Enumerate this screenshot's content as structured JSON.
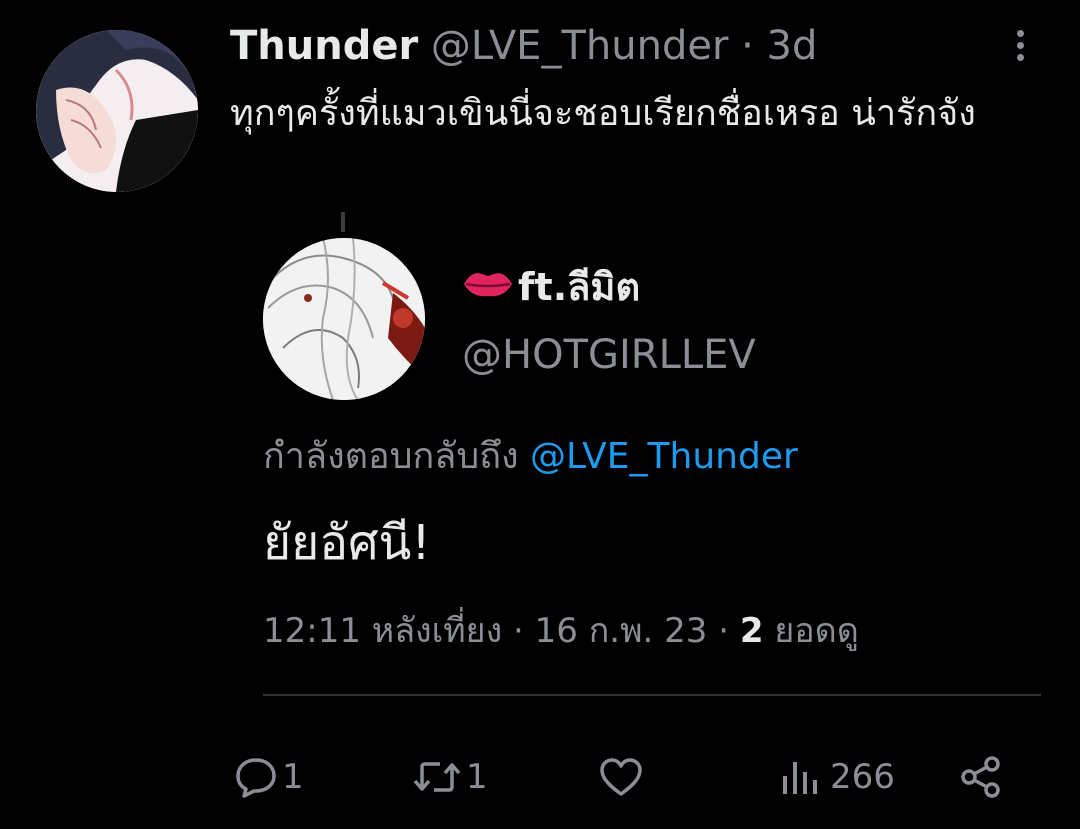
{
  "tweet": {
    "name": "Thunder",
    "handle": "@LVE_Thunder",
    "separator": "·",
    "age": "3d",
    "text": "ทุกๆครั้งที่แมวเขินนี่จะชอบเรียกชื่อเหรอ น่ารักจัง"
  },
  "reply": {
    "name": "ft.ลีมิต",
    "name_emoji": "💋",
    "handle": "@HOTGIRLLEV",
    "replying_prefix": "กำลังตอบกลับถึง",
    "replying_mention": "@LVE_Thunder",
    "text": "ยัยอัศนี!",
    "time": "12:11 หลังเที่ยง",
    "dot1": "·",
    "date": "16 ก.พ. 23",
    "dot2": "·",
    "views_count": "2",
    "views_label": "ยอดดู"
  },
  "actions": {
    "reply_count": "1",
    "retweet_count": "1",
    "views": "266"
  },
  "icons": {
    "more": "more-vertical-icon",
    "reply": "comment-icon",
    "retweet": "retweet-icon",
    "like": "heart-icon",
    "views": "analytics-icon",
    "share": "share-icon",
    "lips": "kiss-mark-icon"
  },
  "colors": {
    "background": "#000000",
    "text": "#e7e9ea",
    "muted": "#8b8f94",
    "link": "#1d9bf0",
    "lips": "#e0245e"
  }
}
